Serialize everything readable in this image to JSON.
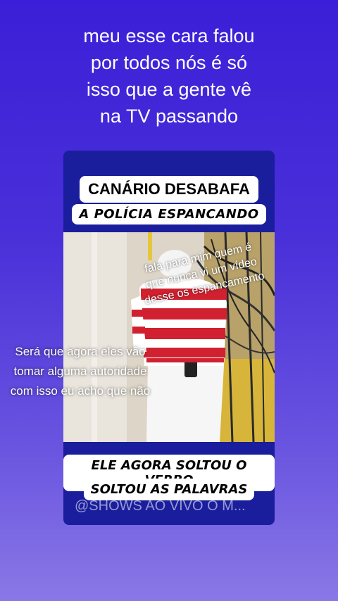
{
  "caption": {
    "lines": [
      "meu esse cara falou",
      "por todos nós é só",
      "isso que a gente vê",
      "na TV passando"
    ]
  },
  "card": {
    "title": "CANÁRIO DESABAFA",
    "subtitle": "A POLÍCIA ESPANCANDO",
    "bottom_line1": "ELE AGORA SOLTOU O VERBO",
    "bottom_line2": "SOLTOU AS PALAVRAS",
    "watermark": "@SHOWS AO VIVO O M..."
  },
  "overlays": {
    "right_text": "fala para mim quem é que nunca vi um vídeo desse os espancamento",
    "left_text": "Será que agora eles vão tomar alguma autoridade com isso eu acho que não"
  },
  "colors": {
    "background_top": "#3b1fd8",
    "background_bottom": "#8a78e6",
    "card": "#1a1e9c"
  }
}
